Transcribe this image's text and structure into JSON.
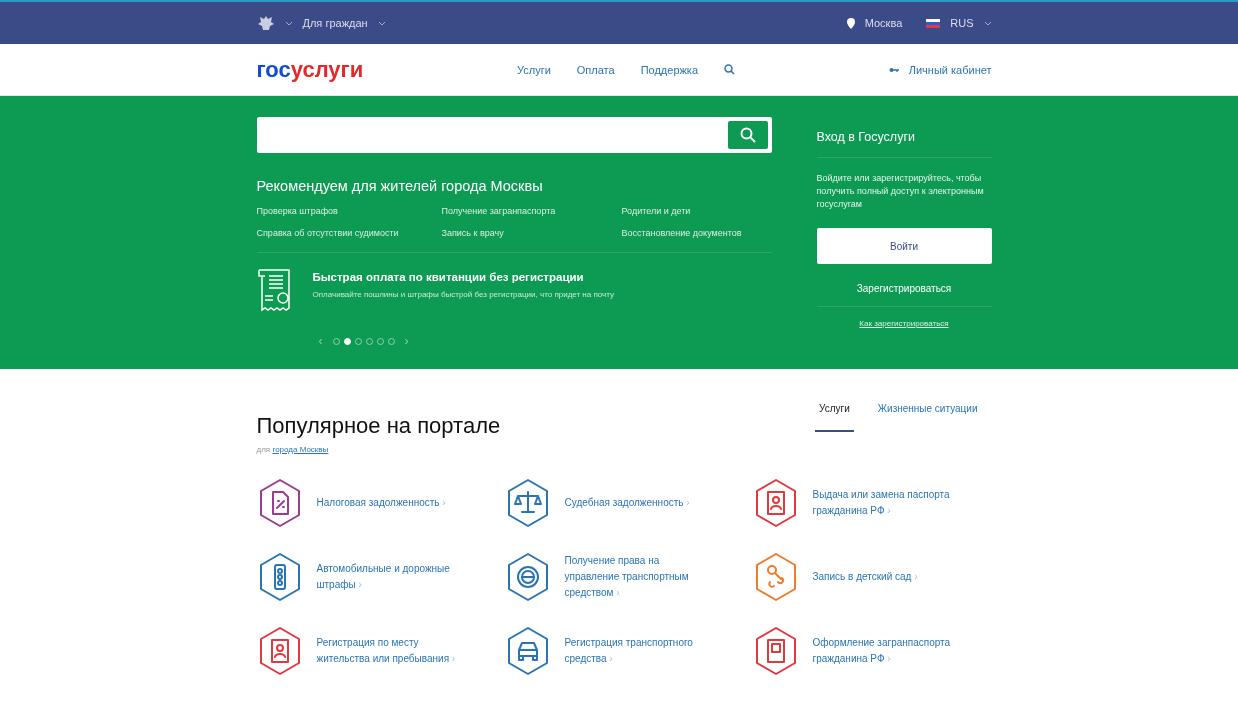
{
  "top_bar": {
    "audience": "Для граждан",
    "city": "Москва",
    "language": "RUS"
  },
  "header": {
    "logo_left": "гос",
    "logo_right": "услуги",
    "nav": [
      "Услуги",
      "Оплата",
      "Поддержка"
    ],
    "account": "Личный кабинет"
  },
  "hero": {
    "recommend_title": "Рекомендуем для жителей города Москвы",
    "links": [
      "Проверка штрафов",
      "Получение загранпаспорта",
      "Родители и дети",
      "Справка об отсутствии судимости",
      "Запись к врачу",
      "Восстановление документов"
    ],
    "promo": {
      "title": "Быстрая оплата по квитанции без регистрации",
      "text": "Оплачивайте пошлины и штрафы быстрой без регистрации, что придет на почту"
    },
    "carousel": {
      "prev": "‹",
      "next": "›",
      "dots": [
        {
          "selected": false
        },
        {
          "selected": true
        },
        {
          "selected": false
        },
        {
          "selected": false
        },
        {
          "selected": false
        },
        {
          "selected": false
        }
      ]
    }
  },
  "login": {
    "title": "Вход в Госуслуги",
    "text": "Войдите или зарегистрируйтесь, чтобы получить полный доступ к электронным госуслугам",
    "login_button": "Войти",
    "register": "Зарегистрироваться",
    "how_to": "Как зарегистрироваться"
  },
  "popular": {
    "title": "Популярное на портале",
    "subtitle_prefix": "для",
    "subtitle_link": "города Москвы",
    "tabs": [
      {
        "label": "Услуги",
        "selected": true
      },
      {
        "label": "Жизненные ситуации",
        "selected": false
      }
    ],
    "items": [
      {
        "title": "Налоговая задолженность",
        "arrow": "›",
        "kind": "tax",
        "color": "#9b3d8e"
      },
      {
        "title": "Судебная задолженность",
        "arrow": "›",
        "kind": "scales",
        "color": "#2a74b4"
      },
      {
        "title": "Выдача или замена паспорта гражданина РФ",
        "arrow": "›",
        "kind": "passport",
        "color": "#e03a3e"
      },
      {
        "title": "Автомобильные и дорожные штрафы",
        "arrow": "›",
        "kind": "traffic",
        "color": "#2a74b4"
      },
      {
        "title": "Получение права на управление транспортным средством",
        "arrow": "›",
        "kind": "wheel",
        "color": "#2a74b4"
      },
      {
        "title": "Запись в детский сад",
        "arrow": "›",
        "kind": "pacifier",
        "color": "#f07b2a"
      },
      {
        "title": "Регистрация по месту жительства или пребывания",
        "arrow": "›",
        "kind": "passport",
        "color": "#e03a3e"
      },
      {
        "title": "Регистрация транспортного средства",
        "arrow": "›",
        "kind": "car",
        "color": "#2a74b4"
      },
      {
        "title": "Оформление загранпаспорта гражданина РФ",
        "arrow": "›",
        "kind": "book",
        "color": "#e03a3e"
      }
    ]
  }
}
